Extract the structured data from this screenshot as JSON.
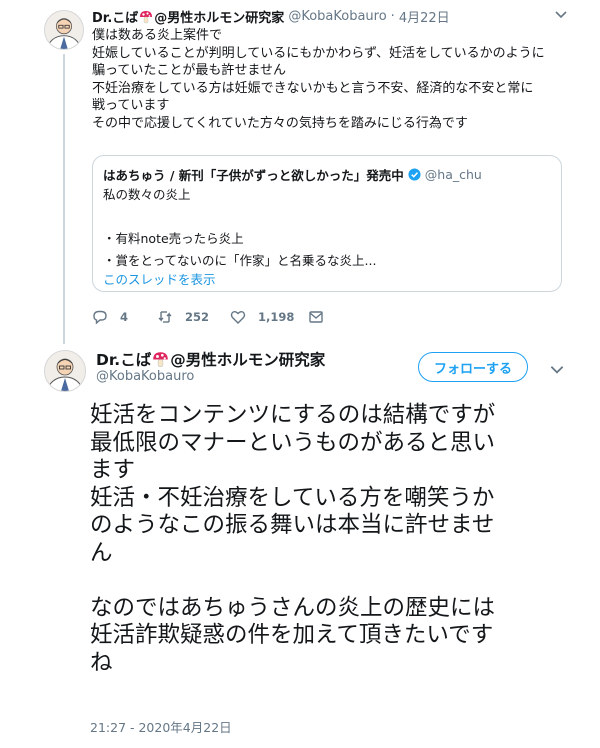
{
  "tweet1": {
    "name": "Dr.こば",
    "name_suffix": "@男性ホルモン研究家",
    "handle": "@KobaKobauro",
    "date": "4月22日",
    "lines": [
      "僕は数ある炎上案件で",
      "妊娠していることが判明しているにもかかわらず、妊活をしているかのように",
      "騙っていたことが最も許せません",
      "不妊治療をしている方は妊娠できないかもと言う不安、経済的な不安と常に",
      "戦っています",
      "その中で応援してくれていた方々の気持ちを踏みにじる行為です"
    ],
    "quote": {
      "name": "はあちゅう / 新刊「子供がずっと欲しかった」発売中",
      "handle": "@ha_chu",
      "text": "私の数々の炎上",
      "bullet1": "・有料note売ったら炎上",
      "bullet2": "・賞をとってないのに「作家」と名乗るな炎上...",
      "show_thread": "このスレッドを表示"
    },
    "actions": {
      "replies": "4",
      "retweets": "252",
      "likes": "1,198"
    }
  },
  "tweet2": {
    "name": "Dr.こば",
    "name_suffix": "@男性ホルモン研究家",
    "handle": "@KobaKobauro",
    "follow_label": "フォローする",
    "lines": [
      "妊活をコンテンツにするのは結構ですが",
      "最低限のマナーというものがあると思い",
      "ます",
      "妊活・不妊治療をしている方を嘲笑うか",
      "のようなこの振る舞いは本当に許せませ",
      "ん",
      "",
      "なのではあちゅうさんの炎上の歴史には",
      "妊活詐欺疑惑の件を加えて頂きたいです",
      "ね"
    ],
    "timestamp": "21:27 - 2020年4月22日"
  },
  "colors": {
    "accent": "#1da1f2",
    "secondary_text": "#657786",
    "border": "#ccd6dd",
    "link": "#1b95e0"
  },
  "icons": [
    "doctor-avatar",
    "mushroom-emoji",
    "verified-badge",
    "chevron-down-icon",
    "reply-icon",
    "retweet-icon",
    "like-icon",
    "dm-icon"
  ]
}
